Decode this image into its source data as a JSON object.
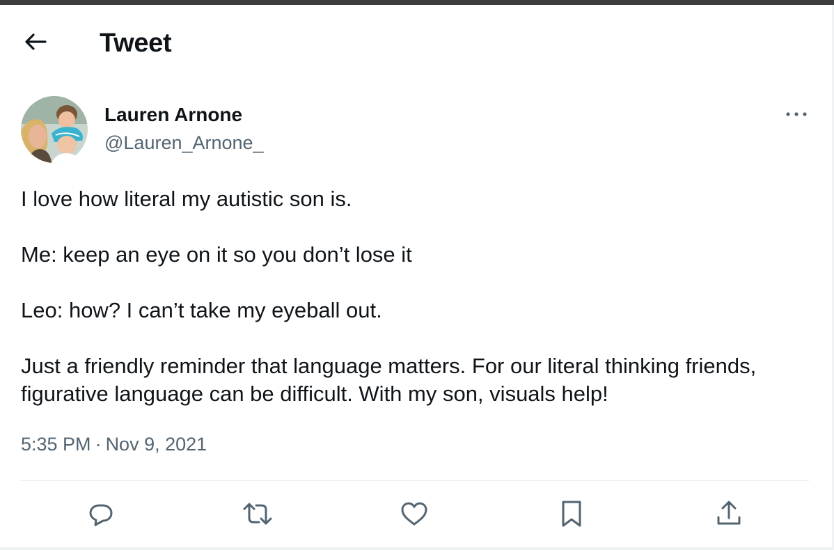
{
  "header": {
    "title": "Tweet",
    "back_icon": "arrow-left-icon"
  },
  "author": {
    "display_name": "Lauren Arnone",
    "handle": "@Lauren_Arnone_"
  },
  "tweet": {
    "paragraphs": [
      "I love how literal my autistic son is.",
      "Me: keep an eye on it so you don’t lose it",
      "Leo: how? I can’t take my eyeball out.",
      "Just a friendly reminder that language matters. For our literal thinking friends, figurative language can be difficult. With my son, visuals help!"
    ],
    "time": "5:35 PM",
    "separator": "·",
    "date": "Nov 9, 2021"
  },
  "actions": [
    "reply-icon",
    "retweet-icon",
    "like-icon",
    "bookmark-icon",
    "share-icon"
  ],
  "colors": {
    "text": "#0f1419",
    "secondary": "#536471",
    "divider": "#e1e8ed"
  }
}
